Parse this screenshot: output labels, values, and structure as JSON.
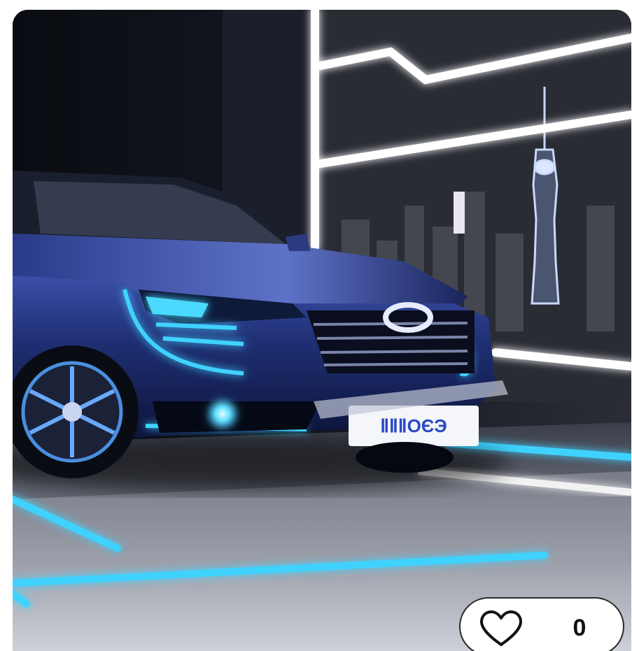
{
  "image": {
    "description_icon": "car-photo",
    "plate_text": "ⅡⅡⅡOЄЭ"
  },
  "like": {
    "icon": "heart-outline-icon",
    "count": "0"
  },
  "colors": {
    "accent_glow": "#3fd2ff",
    "background": "#ffffff",
    "pill_border": "#2b2b2b",
    "car_body": "#1f2f73"
  }
}
